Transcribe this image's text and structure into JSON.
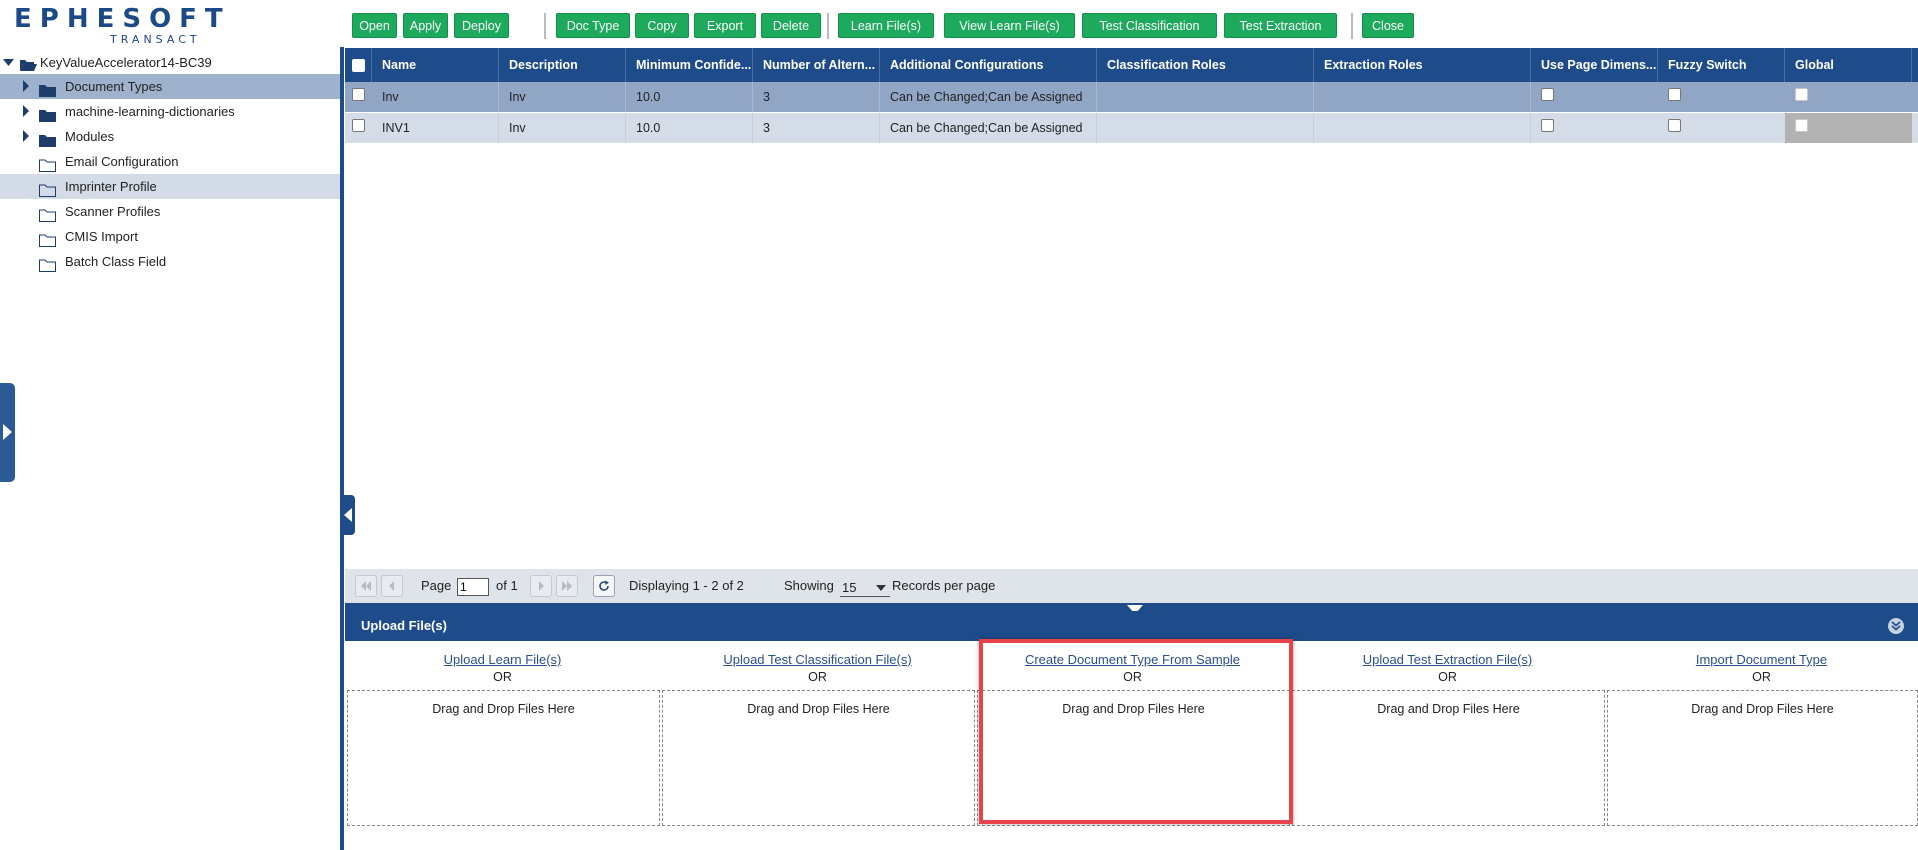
{
  "logo": {
    "brand": "EPHESOFT",
    "sub": "TRANSACT"
  },
  "tree": {
    "root": "KeyValueAccelerator14-BC39",
    "items": [
      {
        "label": "Document Types",
        "expandable": true,
        "filled": true,
        "selected": true
      },
      {
        "label": "machine-learning-dictionaries",
        "expandable": true,
        "filled": true
      },
      {
        "label": "Modules",
        "expandable": true,
        "filled": true
      },
      {
        "label": "Email Configuration",
        "expandable": false,
        "filled": false
      },
      {
        "label": "Imprinter Profile",
        "expandable": false,
        "filled": false,
        "hover": true
      },
      {
        "label": "Scanner Profiles",
        "expandable": false,
        "filled": false
      },
      {
        "label": "CMIS Import",
        "expandable": false,
        "filled": false
      },
      {
        "label": "Batch Class Field",
        "expandable": false,
        "filled": false
      }
    ]
  },
  "toolbar": {
    "open": "Open",
    "apply": "Apply",
    "deploy": "Deploy",
    "doc_type": "Doc Type",
    "copy": "Copy",
    "export": "Export",
    "delete": "Delete",
    "learn_files": "Learn File(s)",
    "view_learn_files": "View Learn File(s)",
    "test_classification": "Test Classification",
    "test_extraction": "Test Extraction",
    "close": "Close",
    "color": "#1daa5c"
  },
  "grid": {
    "headers": [
      "Name",
      "Description",
      "Minimum Confide...",
      "Number of Altern...",
      "Additional Configurations",
      "Classification Roles",
      "Extraction Roles",
      "Use Page Dimens...",
      "Fuzzy Switch",
      "Global"
    ],
    "rows": [
      {
        "name": "Inv",
        "description": "Inv",
        "min_confidence": "10.0",
        "alternates": "3",
        "config": "Can be Changed;Can be Assigned",
        "class_roles": "",
        "extr_roles": ""
      },
      {
        "name": "INV1",
        "description": "Inv",
        "min_confidence": "10.0",
        "alternates": "3",
        "config": "Can be Changed;Can be Assigned",
        "class_roles": "",
        "extr_roles": ""
      }
    ],
    "header_color": "#1e4b8a"
  },
  "pager": {
    "page_label": "Page",
    "page_value": "1",
    "of_label": "of 1",
    "displaying": "Displaying 1 - 2 of 2",
    "showing_label": "Showing",
    "page_size": "15",
    "records_label": "Records per page"
  },
  "upload": {
    "title": "Upload File(s)",
    "or": "OR",
    "drop_text": "Drag and Drop Files Here",
    "columns": [
      "Upload Learn File(s)",
      "Upload Test Classification File(s)",
      "Create Document Type From Sample",
      "Upload Test Extraction File(s)",
      "Import Document Type"
    ],
    "highlight_color": "#e8424b"
  }
}
